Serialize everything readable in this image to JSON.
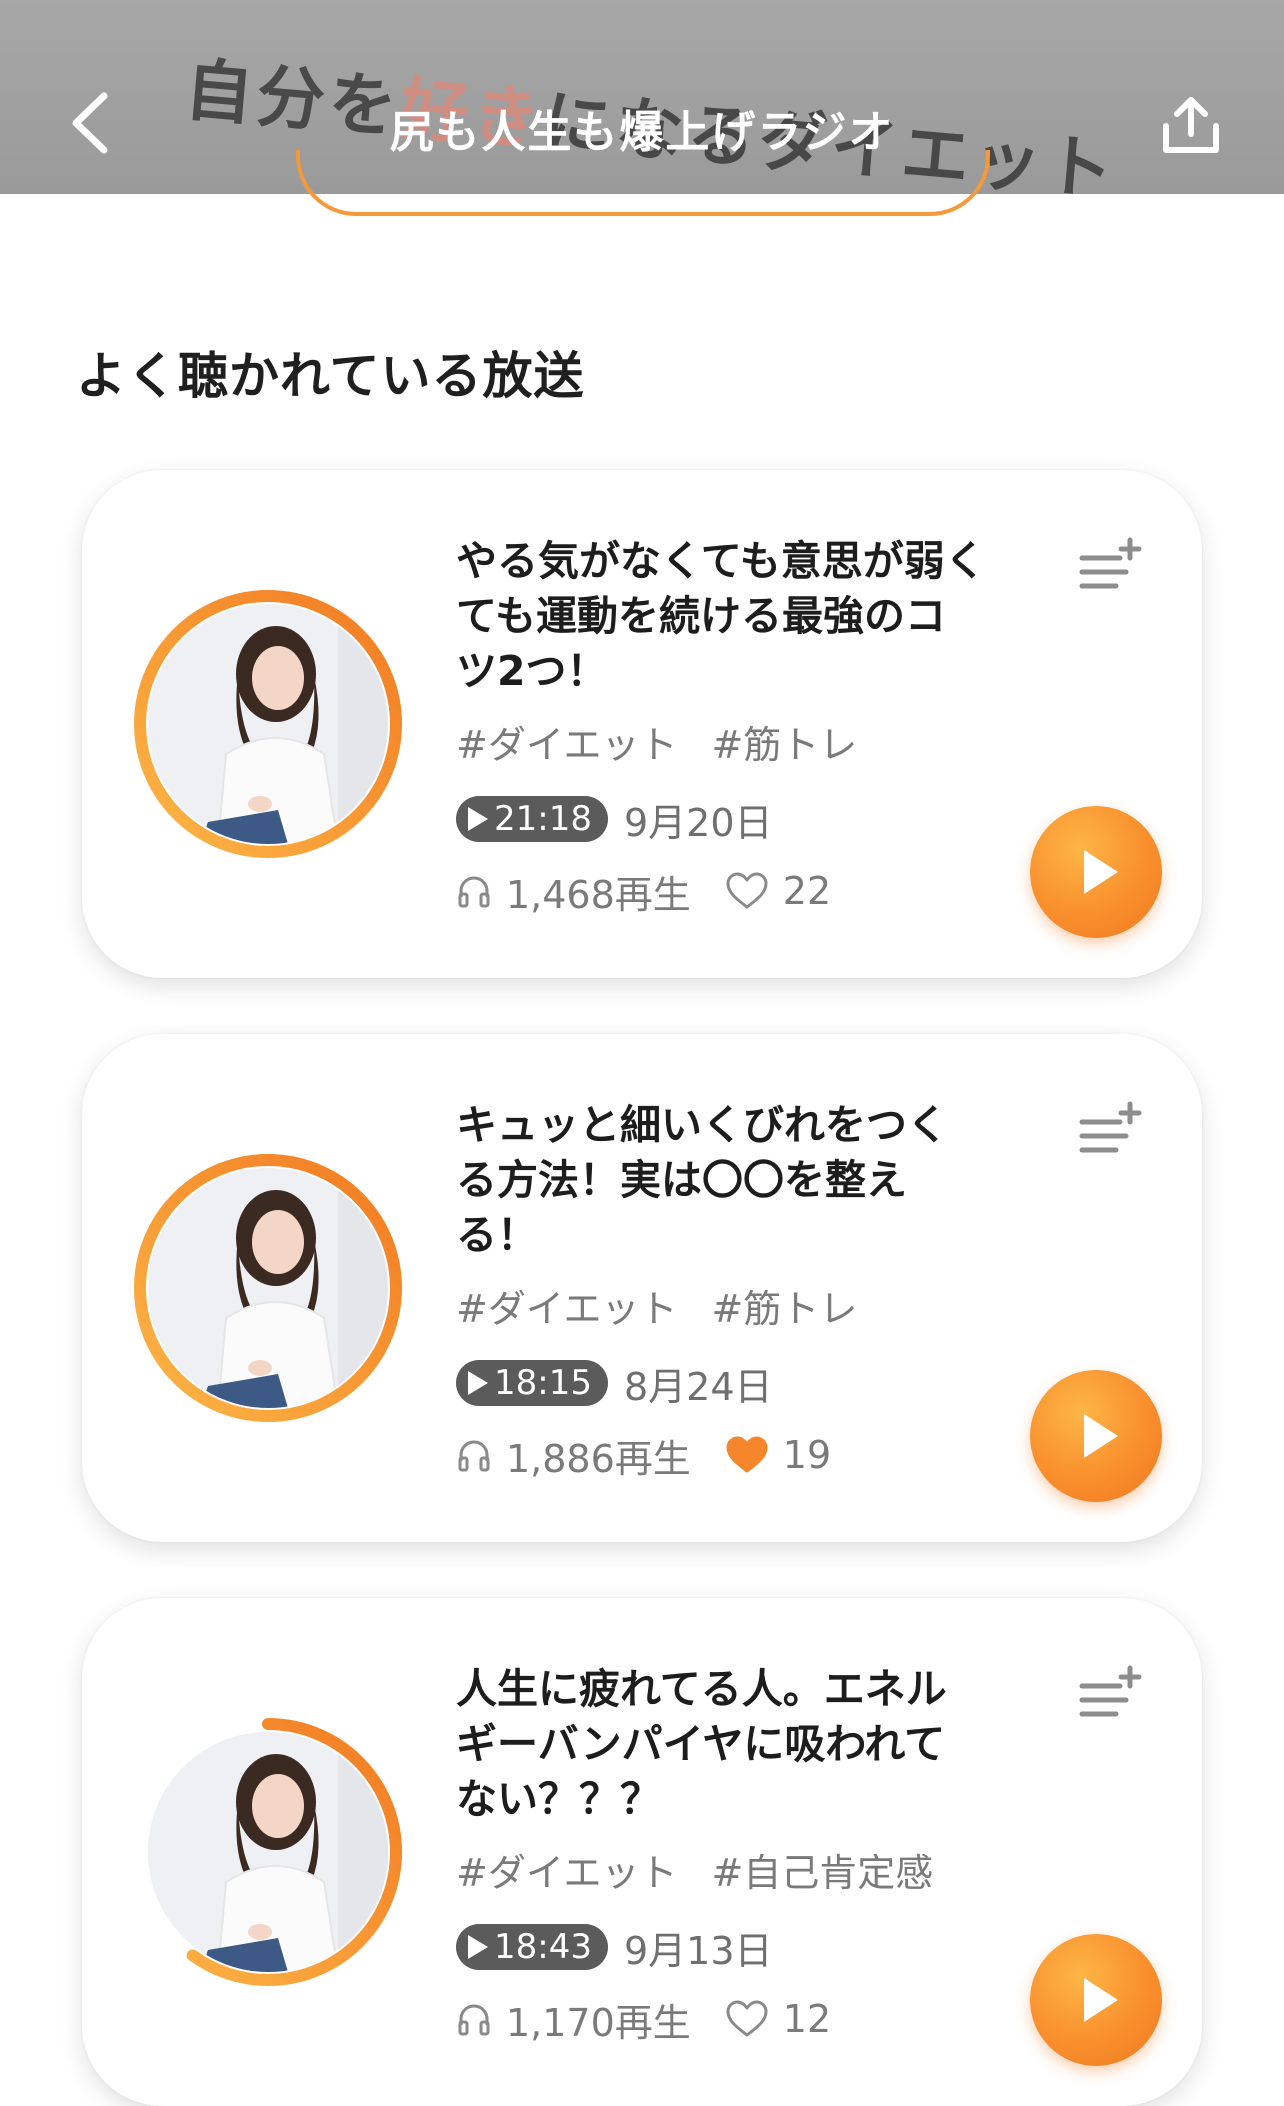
{
  "header": {
    "banner_prefix": "自分を",
    "banner_highlight": "好き",
    "banner_suffix": "になるダイエット",
    "title": "尻も人生も爆上げラジオ",
    "back_icon": "chevron-left-icon",
    "share_icon": "share-upload-icon"
  },
  "section": {
    "title": "よく聴かれている放送"
  },
  "colors": {
    "accent": "#f98f2d",
    "badge": "#5b5b5b",
    "liked_heart": "#f5862b"
  },
  "episodes": [
    {
      "title": "やる気がなくても意思が弱くても運動を続ける最強のコツ2つ！",
      "tags": [
        "#ダイエット",
        "#筋トレ"
      ],
      "duration": "21:18",
      "date": "9月20日",
      "plays": "1,468再生",
      "likes": "22",
      "liked": false,
      "progress": 1.0
    },
    {
      "title": "キュッと細いくびれをつくる方法！実は〇〇を整える！",
      "tags": [
        "#ダイエット",
        "#筋トレ"
      ],
      "duration": "18:15",
      "date": "8月24日",
      "plays": "1,886再生",
      "likes": "19",
      "liked": true,
      "progress": 1.0
    },
    {
      "title": "人生に疲れてる人。エネルギーバンパイヤに吸われてない？？？",
      "tags": [
        "#ダイエット",
        "#自己肯定感"
      ],
      "duration": "18:43",
      "date": "9月13日",
      "plays": "1,170再生",
      "likes": "12",
      "liked": false,
      "progress": 0.6
    }
  ]
}
